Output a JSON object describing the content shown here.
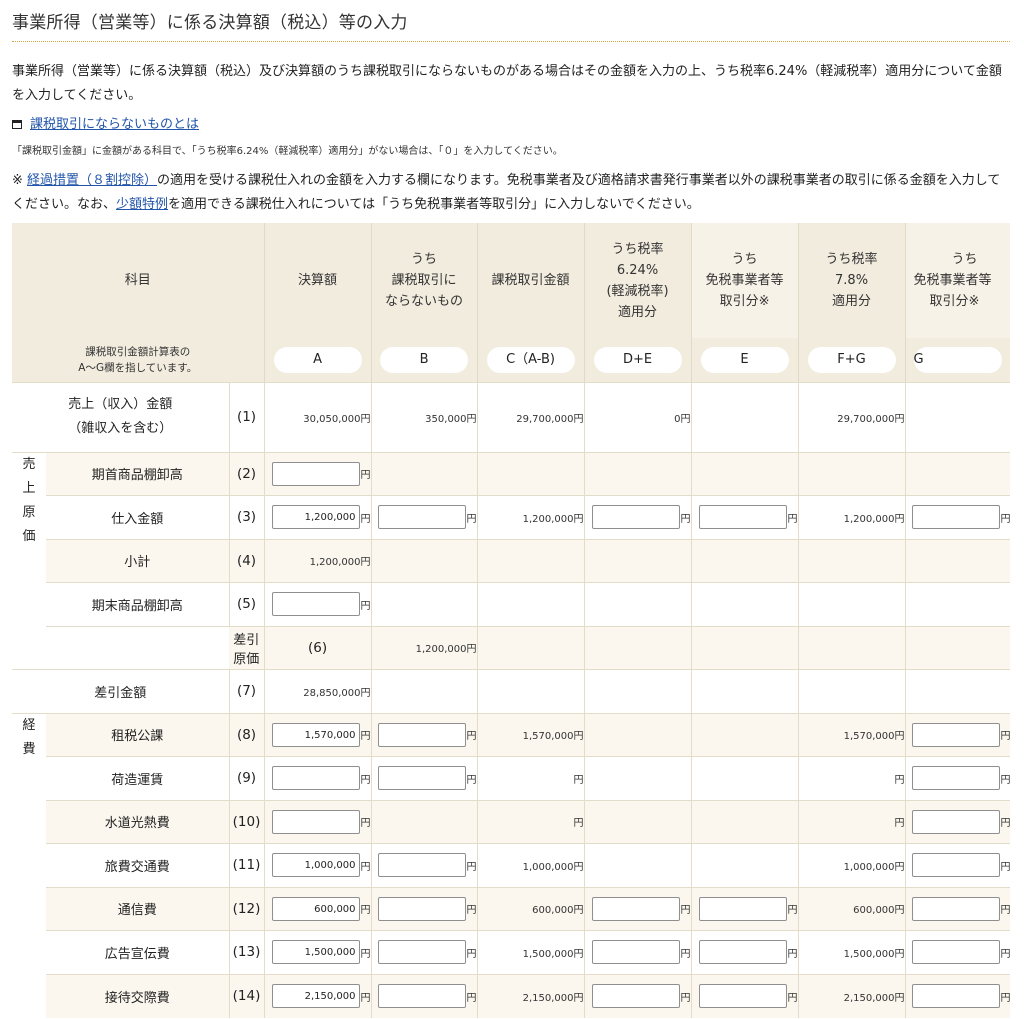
{
  "page": {
    "title": "事業所得（営業等）に係る決算額（税込）等の入力",
    "intro": "事業所得（営業等）に係る決算額（税込）及び決算額のうち課税取引にならないものがある場合はその金額を入力の上、うち税率6.24%（軽減税率）適用分について金額を入力してください。",
    "link_nontaxable": "課税取引にならないものとは",
    "small_note": "「課税取引金額」に金額がある科目で、「うち税率6.24%（軽減税率）適用分」がない場合は、「０」を入力してください。",
    "note_prefix": "※ ",
    "note_link1": "経過措置（８割控除）",
    "note_mid": "の適用を受ける課税仕入れの金額を入力する欄になります。免税事業者及び適格請求書発行事業者以外の課税事業者の取引に係る金額を入力してください。なお、",
    "note_link2": "少額特例",
    "note_suffix": "を適用できる課税仕入れについては「うち免税事業者等取引分」に入力しないでください。"
  },
  "table": {
    "header": {
      "subject": "科目",
      "subject_note_1": "課税取引金額計算表の",
      "subject_note_2": "A～G欄を指しています。",
      "col_a_1": "決算額",
      "col_b_1": "うち",
      "col_b_2": "課税取引に",
      "col_b_3": "ならないもの",
      "col_c_1": "課税取引金額",
      "col_de_1": "うち税率",
      "col_de_2": "6.24%",
      "col_de_3": "(軽減税率)",
      "col_de_4": "適用分",
      "col_e_1": "うち",
      "col_e_2": "免税事業者等",
      "col_e_3": "取引分※",
      "col_fg_1": "うち税率",
      "col_fg_2": "7.8%",
      "col_fg_3": "適用分",
      "col_g_1": "うち",
      "col_g_2": "免税事業者等",
      "col_g_3": "取引分※",
      "pill_a": "A",
      "pill_b": "B",
      "pill_c": "C（A-B)",
      "pill_de": "D+E",
      "pill_e": "E",
      "pill_fg": "F+G",
      "pill_g": "G"
    },
    "yen": "円",
    "group_cost": [
      "売",
      "上",
      "原",
      "価"
    ],
    "group_exp": [
      "経",
      "費"
    ],
    "rows": {
      "r1": {
        "label1": "売上（収入）金額",
        "label2": "（雑収入を含む）",
        "num": "(1)",
        "a": "30,050,000円",
        "b": "350,000円",
        "c": "29,700,000円",
        "de": "0円",
        "fg": "29,700,000円"
      },
      "r2": {
        "label": "期首商品棚卸高",
        "num": "(2)",
        "a": ""
      },
      "r3": {
        "label": "仕入金額",
        "num": "(3)",
        "a": "1,200,000",
        "b": "",
        "c": "1,200,000円",
        "de": "",
        "e": "",
        "fg": "1,200,000円",
        "g": ""
      },
      "r4": {
        "label": "小計",
        "num": "(4)",
        "a": "1,200,000円"
      },
      "r5": {
        "label": "期末商品棚卸高",
        "num": "(5)",
        "a": ""
      },
      "r6": {
        "label": "差引原価",
        "num": "(6)",
        "a": "1,200,000円"
      },
      "r7": {
        "label": "差引金額",
        "num": "(7)",
        "a": "28,850,000円"
      },
      "r8": {
        "label": "租税公課",
        "num": "(8)",
        "a": "1,570,000",
        "b": "",
        "c": "1,570,000円",
        "fg": "1,570,000円",
        "g": ""
      },
      "r9": {
        "label": "荷造運賃",
        "num": "(9)",
        "a": "",
        "b": "",
        "c": "円",
        "fg": "円",
        "g": ""
      },
      "r10": {
        "label": "水道光熱費",
        "num": "(10)",
        "a": "",
        "c": "円",
        "fg": "円",
        "g": ""
      },
      "r11": {
        "label": "旅費交通費",
        "num": "(11)",
        "a": "1,000,000",
        "b": "",
        "c": "1,000,000円",
        "fg": "1,000,000円",
        "g": ""
      },
      "r12": {
        "label": "通信費",
        "num": "(12)",
        "a": "600,000",
        "b": "",
        "c": "600,000円",
        "de": "",
        "e": "",
        "fg": "600,000円",
        "g": ""
      },
      "r13": {
        "label": "広告宣伝費",
        "num": "(13)",
        "a": "1,500,000",
        "b": "",
        "c": "1,500,000円",
        "de": "",
        "e": "",
        "fg": "1,500,000円",
        "g": ""
      },
      "r14": {
        "label": "接待交際費",
        "num": "(14)",
        "a": "2,150,000",
        "b": "",
        "c": "2,150,000円",
        "de": "",
        "e": "",
        "fg": "2,150,000円",
        "g": ""
      }
    }
  }
}
